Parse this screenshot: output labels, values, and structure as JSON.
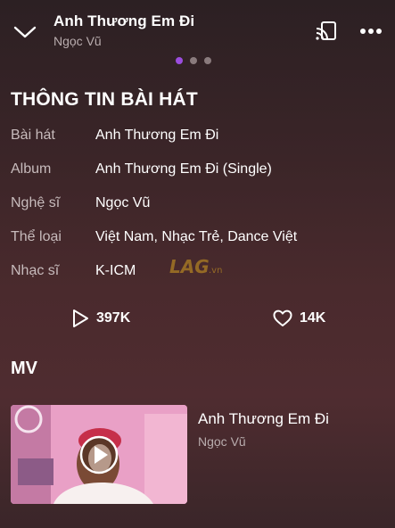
{
  "header": {
    "song_title": "Anh Thương Em Đi",
    "artist": "Ngọc Vũ",
    "pager_count": 3,
    "pager_active_index": 0
  },
  "info": {
    "heading": "THÔNG TIN BÀI HÁT",
    "rows": [
      {
        "label": "Bài hát",
        "value": "Anh Thương Em Đi"
      },
      {
        "label": "Album",
        "value": "Anh Thương Em Đi (Single)"
      },
      {
        "label": "Nghệ sĩ",
        "value": "Ngọc Vũ"
      },
      {
        "label": "Thể loại",
        "value": "Việt Nam, Nhạc Trẻ, Dance Việt"
      },
      {
        "label": "Nhạc sĩ",
        "value": "K-ICM"
      }
    ]
  },
  "stats": {
    "plays": "397K",
    "likes": "14K"
  },
  "mv": {
    "heading": "MV",
    "video_title": "Anh Thương Em Đi",
    "video_artist": "Ngọc Vũ"
  },
  "watermark": {
    "text": "LAG.vn"
  },
  "colors": {
    "accent": "#9b4dde",
    "text_secondary": "#b9adae"
  },
  "icons": [
    "chevron-down-icon",
    "cast-icon",
    "more-icon",
    "play-icon",
    "heart-icon",
    "play-circle-icon"
  ]
}
